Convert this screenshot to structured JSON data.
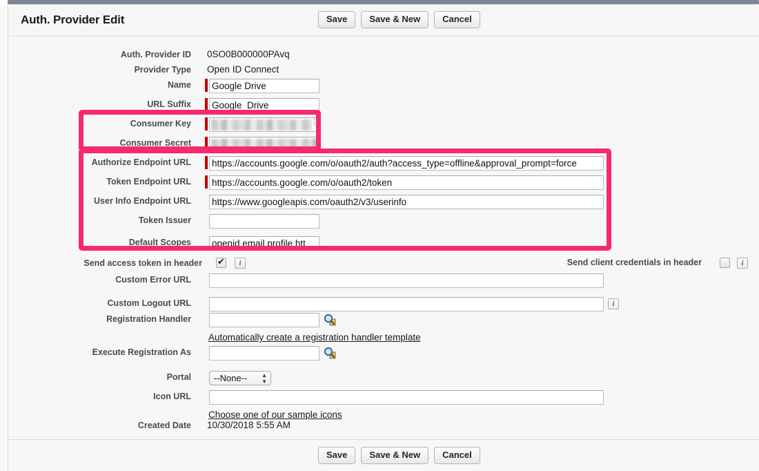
{
  "header": {
    "title": "Auth. Provider Edit",
    "buttons": [
      {
        "label": "Save",
        "name": "save-button-top"
      },
      {
        "label": "Save & New",
        "name": "save-and-new-button-top"
      },
      {
        "label": "Cancel",
        "name": "cancel-button-top"
      }
    ]
  },
  "fields": {
    "auth_provider_id": {
      "label": "Auth. Provider ID",
      "value": "0SO0B000000PAvq"
    },
    "provider_type": {
      "label": "Provider Type",
      "value": "Open ID Connect"
    },
    "name": {
      "label": "Name",
      "value": "Google Drive",
      "placeholder": ""
    },
    "url_suffix": {
      "label": "URL Suffix",
      "value": "Google_Drive",
      "placeholder": ""
    },
    "consumer_key": {
      "label": "Consumer Key",
      "value": "",
      "redacted": true
    },
    "consumer_secret": {
      "label": "Consumer Secret",
      "value": "",
      "redacted": true
    },
    "authorize_endpoint_url": {
      "label": "Authorize Endpoint URL",
      "value": "https://accounts.google.com/o/oauth2/auth?access_type=offline&approval_prompt=force",
      "placeholder": ""
    },
    "token_endpoint_url": {
      "label": "Token Endpoint URL",
      "value": "https://accounts.google.com/o/oauth2/token",
      "placeholder": ""
    },
    "user_info_endpoint_url": {
      "label": "User Info Endpoint URL",
      "value": "https://www.googleapis.com/oauth2/v3/userinfo",
      "placeholder": ""
    },
    "token_issuer": {
      "label": "Token Issuer",
      "value": "",
      "placeholder": ""
    },
    "default_scopes": {
      "label": "Default Scopes",
      "value": "openid email profile htt",
      "placeholder": ""
    },
    "send_access_token_in_header": {
      "label": "Send access token in header",
      "checked": "checked"
    },
    "send_client_credentials_in_header": {
      "label": "Send client credentials in header",
      "checked": ""
    },
    "custom_error_url": {
      "label": "Custom Error URL",
      "value": "",
      "placeholder": ""
    },
    "custom_logout_url": {
      "label": "Custom Logout URL",
      "value": "",
      "placeholder": ""
    },
    "registration_handler": {
      "label": "Registration Handler",
      "value": "",
      "placeholder": ""
    },
    "registration_handler_link": "Automatically create a registration handler template",
    "execute_registration_as": {
      "label": "Execute Registration As",
      "value": "",
      "placeholder": ""
    },
    "portal": {
      "label": "Portal",
      "selected": "--None--"
    },
    "icon_url": {
      "label": "Icon URL",
      "value": "",
      "placeholder": ""
    },
    "icon_url_link": "Choose one of our sample icons",
    "created_date": {
      "label": "Created Date",
      "value": "10/30/2018 5:55 AM"
    }
  },
  "icons": {
    "info": "i",
    "lookup": "search-lookup-icon",
    "select_arrows": "▲▼"
  },
  "footer": {
    "buttons": [
      {
        "label": "Save",
        "name": "save-button-bottom"
      },
      {
        "label": "Save & New",
        "name": "save-and-new-button-bottom"
      },
      {
        "label": "Cancel",
        "name": "cancel-button-bottom"
      }
    ]
  },
  "annotations": {
    "accent_color": "#f72a6d",
    "required_marker_color": "#c00000",
    "box_credentials": "consumer-key-and-secret-highlight",
    "box_endpoints": "endpoint-urls-highlight"
  }
}
